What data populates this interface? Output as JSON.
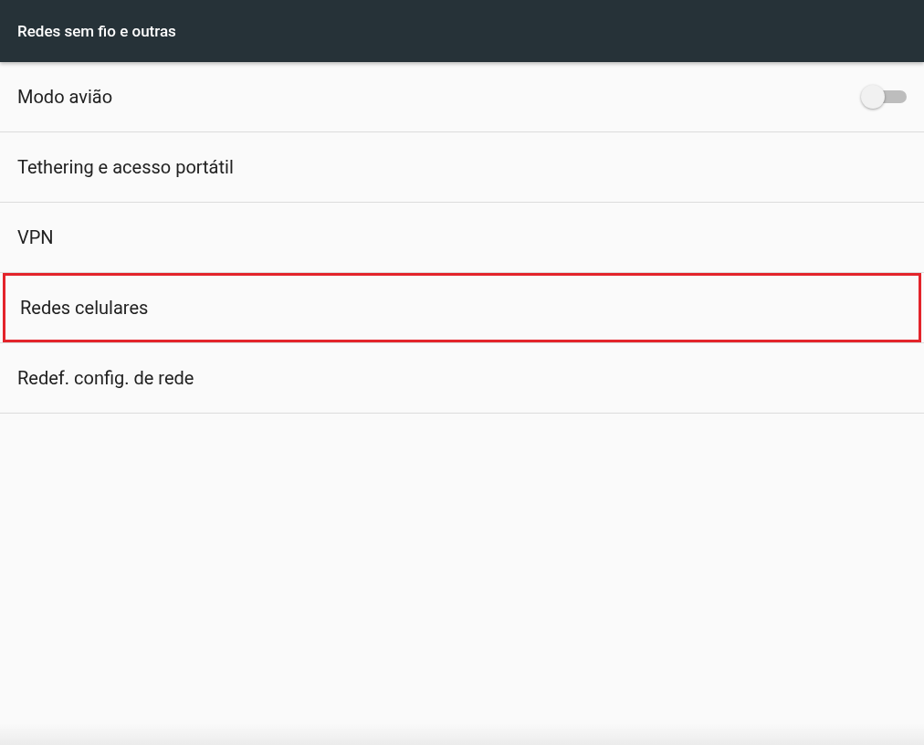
{
  "header": {
    "title": "Redes sem fio e outras"
  },
  "items": [
    {
      "kind": "toggle",
      "label": "Modo avião",
      "on": false,
      "highlighted": false
    },
    {
      "kind": "link",
      "label": "Tethering e acesso portátil",
      "highlighted": false
    },
    {
      "kind": "link",
      "label": "VPN",
      "highlighted": false
    },
    {
      "kind": "link",
      "label": "Redes celulares",
      "highlighted": true
    },
    {
      "kind": "link",
      "label": "Redef. config. de rede",
      "highlighted": false
    }
  ]
}
